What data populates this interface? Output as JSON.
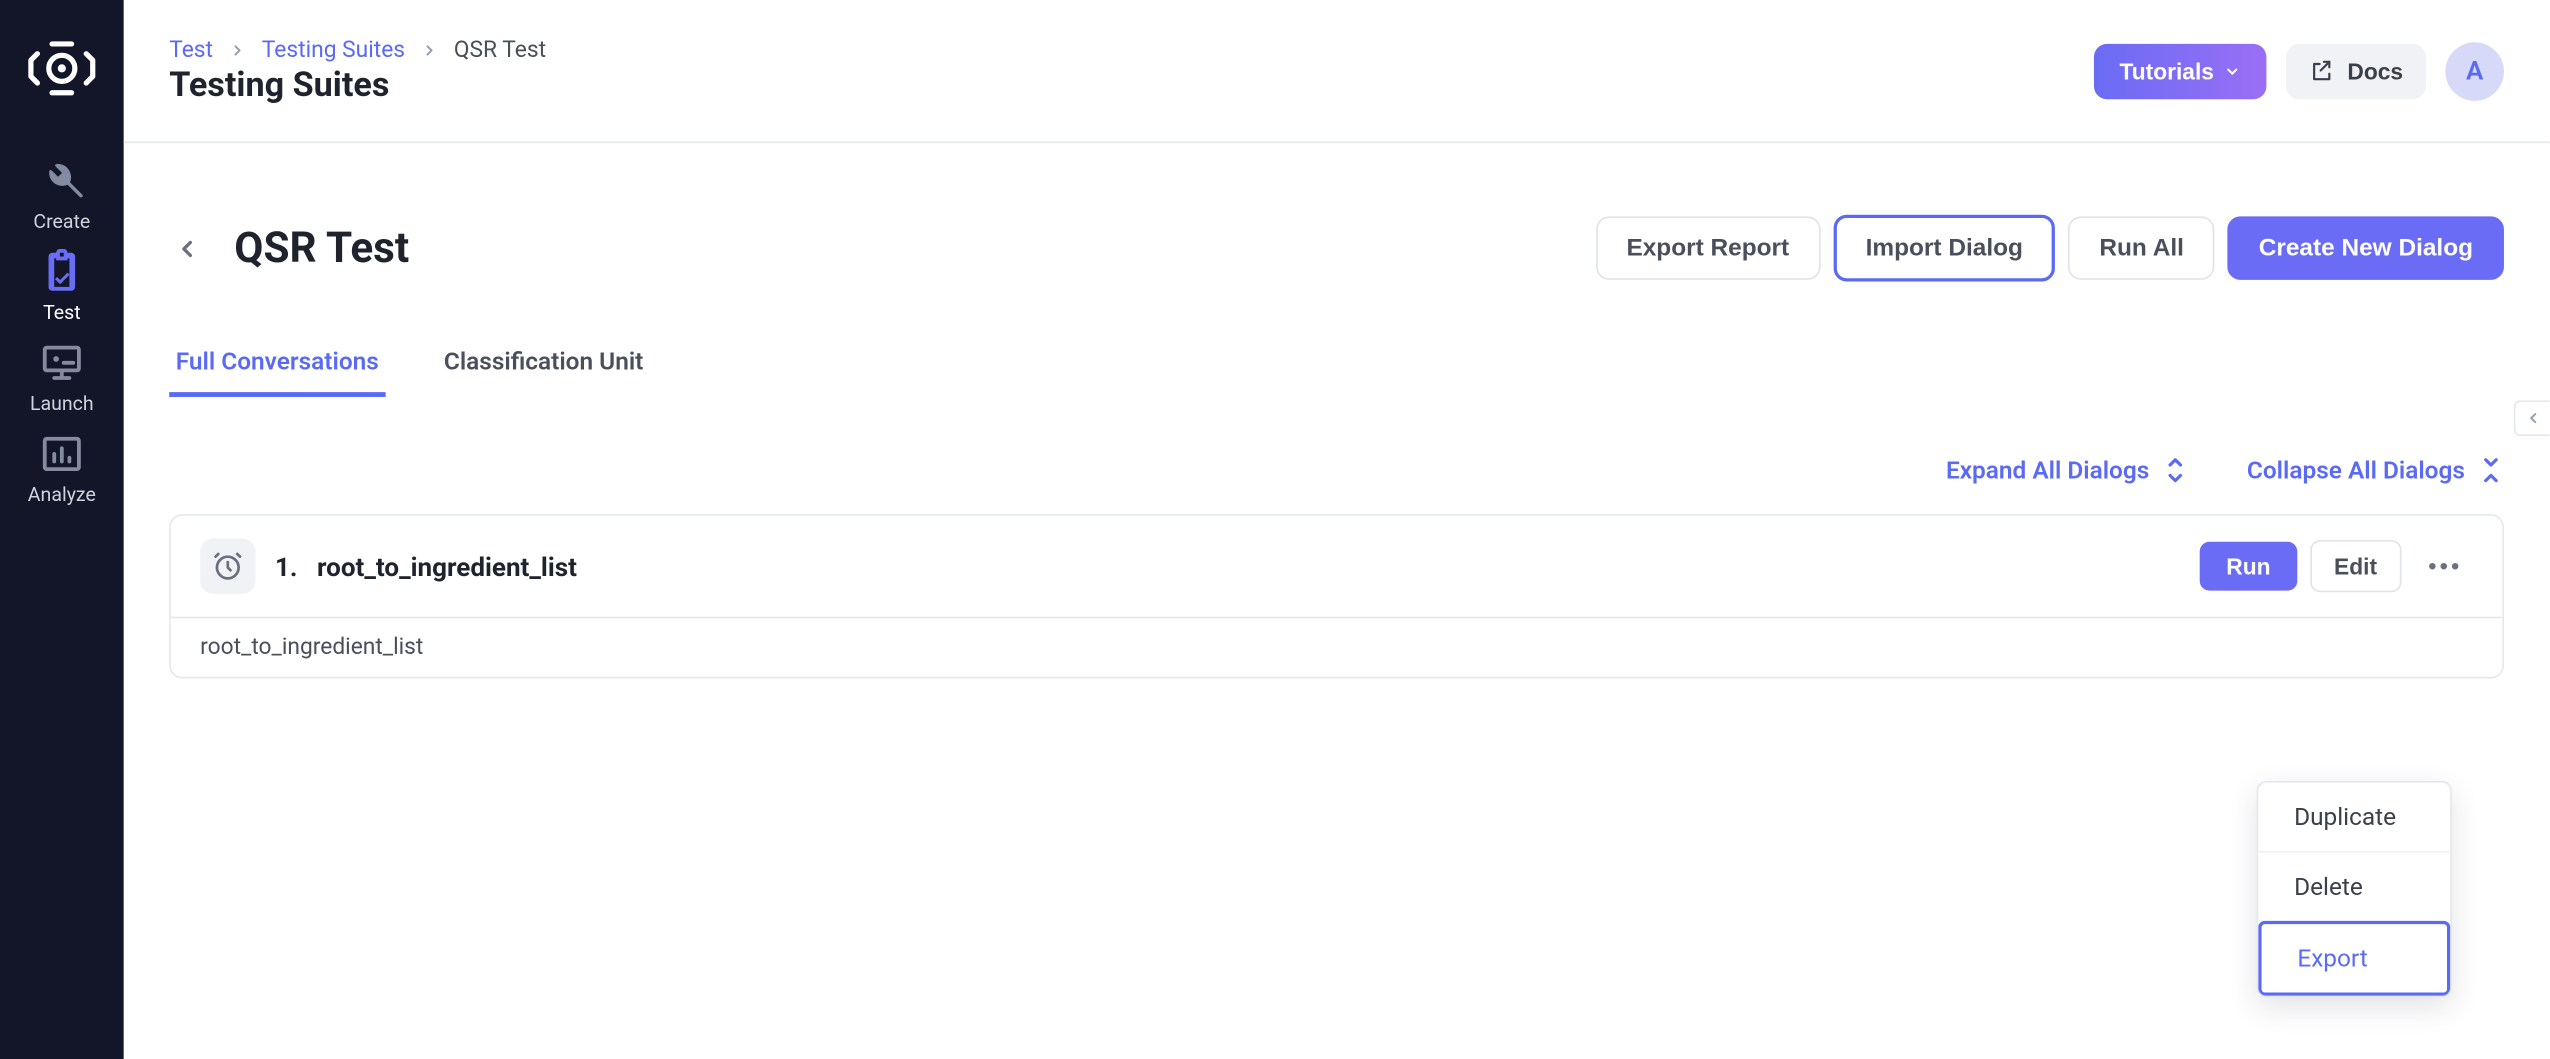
{
  "sidebar": {
    "items": [
      {
        "label": "Create"
      },
      {
        "label": "Test"
      },
      {
        "label": "Launch"
      },
      {
        "label": "Analyze"
      }
    ]
  },
  "breadcrumb": {
    "items": [
      "Test",
      "Testing Suites",
      "QSR Test"
    ]
  },
  "header": {
    "page_title": "Testing Suites",
    "tutorials_label": "Tutorials",
    "docs_label": "Docs",
    "avatar_initial": "A"
  },
  "suite": {
    "title": "QSR Test",
    "actions": {
      "export_report": "Export Report",
      "import_dialog": "Import Dialog",
      "run_all": "Run All",
      "create_new_dialog": "Create New Dialog"
    }
  },
  "tabs": [
    {
      "label": "Full Conversations",
      "active": true
    },
    {
      "label": "Classification Unit",
      "active": false
    }
  ],
  "dialog_controls": {
    "expand_all": "Expand All Dialogs",
    "collapse_all": "Collapse All Dialogs"
  },
  "dialogs": [
    {
      "index": "1.",
      "name": "root_to_ingredient_list",
      "body": "root_to_ingredient_list",
      "run_label": "Run",
      "edit_label": "Edit"
    }
  ],
  "context_menu": {
    "duplicate": "Duplicate",
    "delete": "Delete",
    "export": "Export"
  }
}
